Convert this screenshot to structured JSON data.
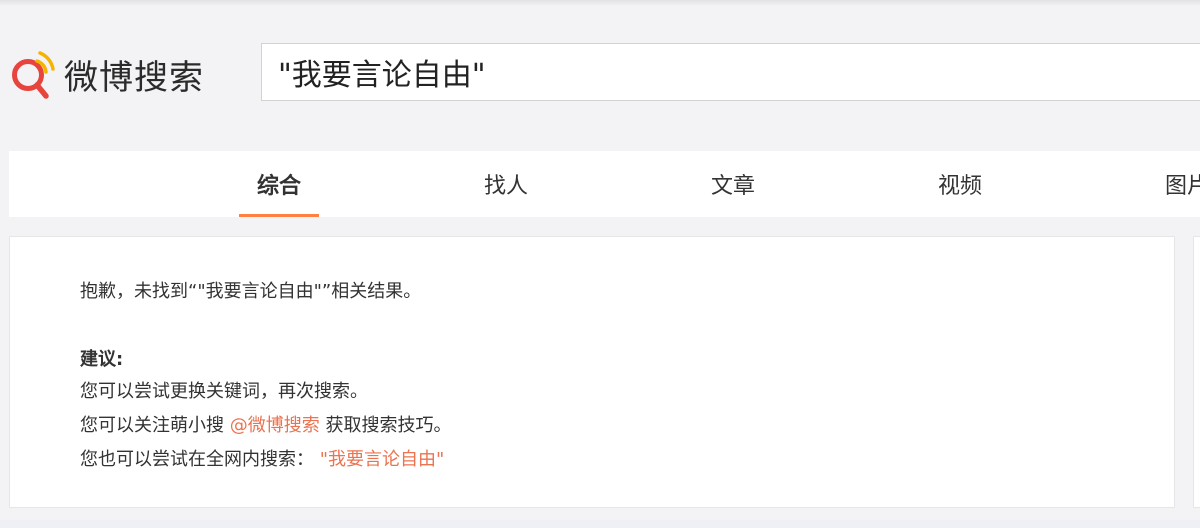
{
  "header": {
    "logo_text": "微博搜索",
    "search_value": "\"我要言论自由\""
  },
  "tabs": [
    {
      "label": "综合",
      "active": true
    },
    {
      "label": "找人",
      "active": false
    },
    {
      "label": "文章",
      "active": false
    },
    {
      "label": "视频",
      "active": false
    },
    {
      "label": "图片",
      "active": false
    }
  ],
  "result": {
    "no_result_prefix": "抱歉，未找到“",
    "no_result_query": "\"我要言论自由\"",
    "no_result_suffix": "”相关结果。",
    "suggestion_title": "建议:",
    "tip1": "您可以尝试更换关键词，再次搜索。",
    "tip2_prefix": "您可以关注萌小搜",
    "tip2_link": "@微博搜索",
    "tip2_suffix": "获取搜索技巧。",
    "tip3_prefix": "您也可以尝试在全网内搜索：",
    "tip3_link": "\"我要言论自由\""
  },
  "colors": {
    "accent": "#ff8140",
    "link": "#eb7350",
    "logo_red": "#e6443c",
    "logo_yellow": "#f5b400"
  }
}
